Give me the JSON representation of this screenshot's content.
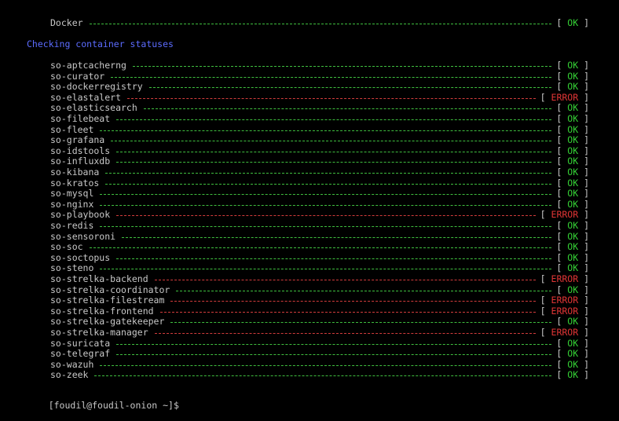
{
  "colors": {
    "background": "#000000",
    "text": "#c8c8c8",
    "ok": "#35d035",
    "error": "#e03535",
    "heading": "#5c6cff"
  },
  "docker": {
    "name": "Docker",
    "status": "OK"
  },
  "section_title": "Checking container statuses",
  "services": [
    {
      "name": "so-aptcacherng",
      "status": "OK"
    },
    {
      "name": "so-curator",
      "status": "OK"
    },
    {
      "name": "so-dockerregistry",
      "status": "OK"
    },
    {
      "name": "so-elastalert",
      "status": "ERROR"
    },
    {
      "name": "so-elasticsearch",
      "status": "OK"
    },
    {
      "name": "so-filebeat",
      "status": "OK"
    },
    {
      "name": "so-fleet",
      "status": "OK"
    },
    {
      "name": "so-grafana",
      "status": "OK"
    },
    {
      "name": "so-idstools",
      "status": "OK"
    },
    {
      "name": "so-influxdb",
      "status": "OK"
    },
    {
      "name": "so-kibana",
      "status": "OK"
    },
    {
      "name": "so-kratos",
      "status": "OK"
    },
    {
      "name": "so-mysql",
      "status": "OK"
    },
    {
      "name": "so-nginx",
      "status": "OK"
    },
    {
      "name": "so-playbook",
      "status": "ERROR"
    },
    {
      "name": "so-redis",
      "status": "OK"
    },
    {
      "name": "so-sensoroni",
      "status": "OK"
    },
    {
      "name": "so-soc",
      "status": "OK"
    },
    {
      "name": "so-soctopus",
      "status": "OK"
    },
    {
      "name": "so-steno",
      "status": "OK"
    },
    {
      "name": "so-strelka-backend",
      "status": "ERROR"
    },
    {
      "name": "so-strelka-coordinator",
      "status": "OK"
    },
    {
      "name": "so-strelka-filestream",
      "status": "ERROR"
    },
    {
      "name": "so-strelka-frontend",
      "status": "ERROR"
    },
    {
      "name": "so-strelka-gatekeeper",
      "status": "OK"
    },
    {
      "name": "so-strelka-manager",
      "status": "ERROR"
    },
    {
      "name": "so-suricata",
      "status": "OK"
    },
    {
      "name": "so-telegraf",
      "status": "OK"
    },
    {
      "name": "so-wazuh",
      "status": "OK"
    },
    {
      "name": "so-zeek",
      "status": "OK"
    }
  ],
  "prompt": "[foudil@foudil-onion ~]$"
}
